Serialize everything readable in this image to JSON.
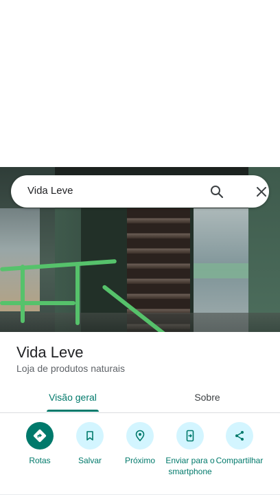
{
  "search": {
    "query": "Vida Leve"
  },
  "place": {
    "title": "Vida Leve",
    "category": "Loja de produtos naturais"
  },
  "tabs": [
    {
      "label": "Visão geral",
      "active": true
    },
    {
      "label": "Sobre",
      "active": false
    }
  ],
  "actions": [
    {
      "label": "Rotas",
      "icon": "directions-icon"
    },
    {
      "label": "Salvar",
      "icon": "bookmark-icon"
    },
    {
      "label": "Próximo",
      "icon": "nearby-icon"
    },
    {
      "label": "Enviar para o smartphone",
      "icon": "send-to-phone-icon"
    },
    {
      "label": "Compartilhar",
      "icon": "share-icon"
    }
  ],
  "colors": {
    "accent": "#00796b",
    "action_bg": "#d3f5ff"
  }
}
